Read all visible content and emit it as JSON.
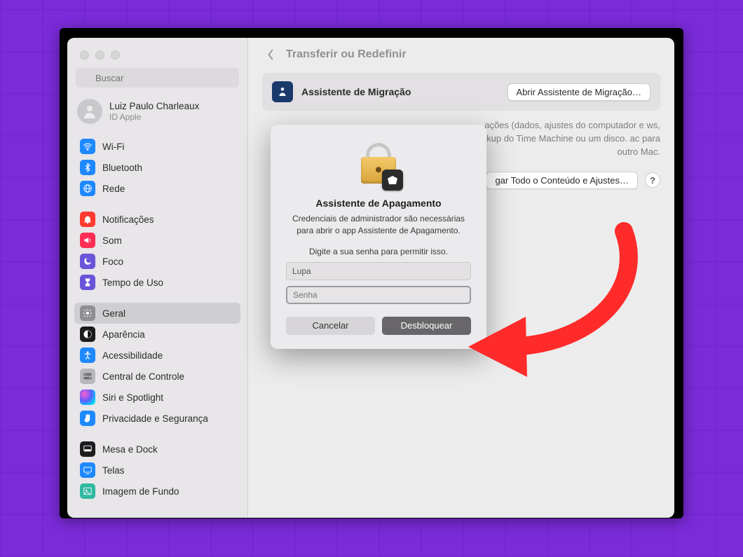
{
  "window": {
    "search_placeholder": "Buscar",
    "user": {
      "name": "Luiz Paulo Charleaux",
      "subtitle": "ID Apple"
    }
  },
  "sidebar": {
    "groups": [
      [
        {
          "label": "Wi-Fi",
          "icon": "wifi",
          "cls": "ic-blue"
        },
        {
          "label": "Bluetooth",
          "icon": "bluetooth",
          "cls": "ic-blue"
        },
        {
          "label": "Rede",
          "icon": "globe",
          "cls": "ic-blue"
        }
      ],
      [
        {
          "label": "Notificações",
          "icon": "bell",
          "cls": "ic-red"
        },
        {
          "label": "Som",
          "icon": "speaker",
          "cls": "ic-pink"
        },
        {
          "label": "Foco",
          "icon": "moon",
          "cls": "ic-purple"
        },
        {
          "label": "Tempo de Uso",
          "icon": "hourglass",
          "cls": "ic-purple"
        }
      ],
      [
        {
          "label": "Geral",
          "icon": "gear",
          "cls": "ic-gray",
          "selected": true
        },
        {
          "label": "Aparência",
          "icon": "appearance",
          "cls": "ic-black"
        },
        {
          "label": "Acessibilidade",
          "icon": "accessibility",
          "cls": "ic-blue"
        },
        {
          "label": "Central de Controle",
          "icon": "switches",
          "cls": "ic-lgray"
        },
        {
          "label": "Siri e Spotlight",
          "icon": "siri",
          "cls": "ic-grad"
        },
        {
          "label": "Privacidade e Segurança",
          "icon": "hand",
          "cls": "ic-blue"
        }
      ],
      [
        {
          "label": "Mesa e Dock",
          "icon": "dock",
          "cls": "ic-black"
        },
        {
          "label": "Telas",
          "icon": "displays",
          "cls": "ic-blue"
        },
        {
          "label": "Imagem de Fundo",
          "icon": "wallpaper",
          "cls": "ic-teal"
        }
      ]
    ]
  },
  "main": {
    "title": "Transferir ou Redefinir",
    "migration": {
      "label": "Assistente de Migração",
      "button": "Abrir Assistente de Migração…",
      "desc_visible": "ações (dados, ajustes do computador e ws, backup do Time Machine ou um disco. ac para outro Mac."
    },
    "erase": {
      "button": "gar Todo o Conteúdo e Ajustes…",
      "help": "?"
    }
  },
  "modal": {
    "title": "Assistente de Apagamento",
    "line1": "Credenciais de administrador são necessárias para abrir o app Assistente de Apagamento.",
    "prompt": "Digite a sua senha para permitir isso.",
    "user_value": "Lupa",
    "password_placeholder": "Senha",
    "cancel": "Cancelar",
    "unlock": "Desbloquear"
  }
}
